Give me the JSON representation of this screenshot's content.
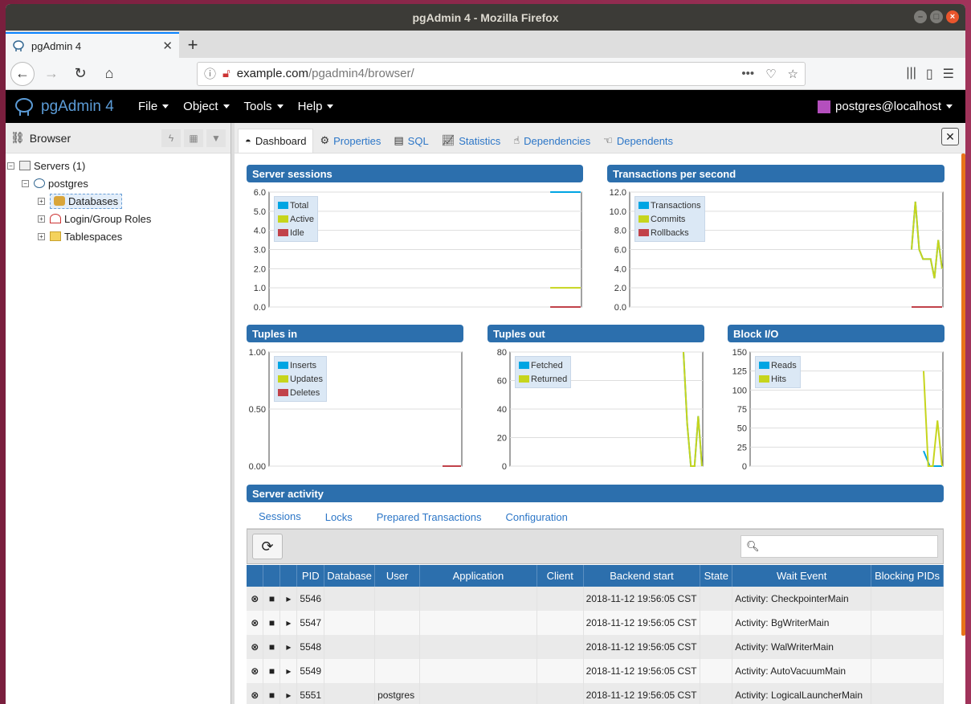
{
  "window": {
    "title": "pgAdmin 4 - Mozilla Firefox"
  },
  "browser": {
    "tab_title": "pgAdmin 4",
    "url_host": "example.com",
    "url_path": "/pgadmin4/browser/",
    "url_more": "•••"
  },
  "app": {
    "brand": "pgAdmin 4",
    "menus": [
      "File",
      "Object",
      "Tools",
      "Help"
    ],
    "user": "postgres@localhost"
  },
  "left_panel": {
    "title": "Browser",
    "tree": {
      "servers": "Servers (1)",
      "server": "postgres",
      "children": [
        "Databases",
        "Login/Group Roles",
        "Tablespaces"
      ]
    }
  },
  "panel_tabs": [
    "Dashboard",
    "Properties",
    "SQL",
    "Statistics",
    "Dependencies",
    "Dependents"
  ],
  "close_label": "✕",
  "colors": {
    "blue": "#00a5e3",
    "green": "#c6d51d",
    "red": "#c1424a",
    "header": "#2c6fad"
  },
  "charts": {
    "server_sessions": {
      "title": "Server sessions",
      "yticks": [
        "6.0",
        "5.0",
        "4.0",
        "3.0",
        "2.0",
        "1.0",
        "0.0"
      ],
      "legend": [
        "Total",
        "Active",
        "Idle"
      ]
    },
    "tps": {
      "title": "Transactions per second",
      "yticks": [
        "12.0",
        "10.0",
        "8.0",
        "6.0",
        "4.0",
        "2.0",
        "0.0"
      ],
      "legend": [
        "Transactions",
        "Commits",
        "Rollbacks"
      ]
    },
    "tuples_in": {
      "title": "Tuples in",
      "yticks": [
        "1.00",
        "0.50",
        "0.00"
      ],
      "legend": [
        "Inserts",
        "Updates",
        "Deletes"
      ]
    },
    "tuples_out": {
      "title": "Tuples out",
      "yticks": [
        "80",
        "60",
        "40",
        "20",
        "0"
      ],
      "legend": [
        "Fetched",
        "Returned"
      ]
    },
    "block_io": {
      "title": "Block I/O",
      "yticks": [
        "150",
        "125",
        "100",
        "75",
        "50",
        "25",
        "0"
      ],
      "legend": [
        "Reads",
        "Hits"
      ]
    }
  },
  "chart_data": [
    {
      "type": "line",
      "title": "Server sessions",
      "ylim": [
        0,
        6
      ],
      "series": [
        {
          "name": "Total",
          "values": [
            6,
            6
          ]
        },
        {
          "name": "Active",
          "values": [
            1,
            1
          ]
        },
        {
          "name": "Idle",
          "values": [
            0,
            0
          ]
        }
      ]
    },
    {
      "type": "line",
      "title": "Transactions per second",
      "ylim": [
        0,
        12
      ],
      "series": [
        {
          "name": "Transactions",
          "values": [
            6,
            11,
            6,
            5,
            5,
            5,
            3,
            7,
            4
          ]
        },
        {
          "name": "Commits",
          "values": [
            6,
            11,
            6,
            5,
            5,
            5,
            3,
            7,
            4
          ]
        },
        {
          "name": "Rollbacks",
          "values": [
            0,
            0,
            0
          ]
        }
      ]
    },
    {
      "type": "line",
      "title": "Tuples in",
      "ylim": [
        0,
        1
      ],
      "series": [
        {
          "name": "Inserts",
          "values": [
            0,
            0
          ]
        },
        {
          "name": "Updates",
          "values": [
            0,
            0
          ]
        },
        {
          "name": "Deletes",
          "values": [
            0,
            0
          ]
        }
      ]
    },
    {
      "type": "line",
      "title": "Tuples out",
      "ylim": [
        0,
        80
      ],
      "series": [
        {
          "name": "Fetched",
          "values": [
            80,
            30,
            0,
            0,
            35,
            0
          ]
        },
        {
          "name": "Returned",
          "values": [
            80,
            30,
            0,
            0,
            35,
            0
          ]
        }
      ]
    },
    {
      "type": "line",
      "title": "Block I/O",
      "ylim": [
        0,
        150
      ],
      "series": [
        {
          "name": "Reads",
          "values": [
            20,
            0,
            0,
            0
          ]
        },
        {
          "name": "Hits",
          "values": [
            125,
            0,
            0,
            60,
            0
          ]
        }
      ]
    }
  ],
  "activity": {
    "title": "Server activity",
    "tabs": [
      "Sessions",
      "Locks",
      "Prepared Transactions",
      "Configuration"
    ],
    "columns": [
      "",
      "",
      "",
      "PID",
      "Database",
      "User",
      "Application",
      "Client",
      "Backend start",
      "State",
      "Wait Event",
      "Blocking PIDs"
    ],
    "rows": [
      {
        "pid": "5546",
        "database": "",
        "user": "",
        "application": "",
        "client": "",
        "start": "2018-11-12 19:56:05 CST",
        "state": "",
        "wait": "Activity: CheckpointerMain",
        "blocking": ""
      },
      {
        "pid": "5547",
        "database": "",
        "user": "",
        "application": "",
        "client": "",
        "start": "2018-11-12 19:56:05 CST",
        "state": "",
        "wait": "Activity: BgWriterMain",
        "blocking": ""
      },
      {
        "pid": "5548",
        "database": "",
        "user": "",
        "application": "",
        "client": "",
        "start": "2018-11-12 19:56:05 CST",
        "state": "",
        "wait": "Activity: WalWriterMain",
        "blocking": ""
      },
      {
        "pid": "5549",
        "database": "",
        "user": "",
        "application": "",
        "client": "",
        "start": "2018-11-12 19:56:05 CST",
        "state": "",
        "wait": "Activity: AutoVacuumMain",
        "blocking": ""
      },
      {
        "pid": "5551",
        "database": "",
        "user": "postgres",
        "application": "",
        "client": "",
        "start": "2018-11-12 19:56:05 CST",
        "state": "",
        "wait": "Activity: LogicalLauncherMain",
        "blocking": ""
      }
    ]
  }
}
